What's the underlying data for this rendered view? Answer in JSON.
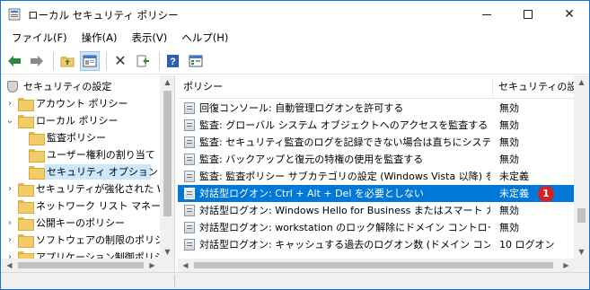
{
  "window": {
    "title": "ローカル セキュリティ ポリシー"
  },
  "menu": [
    "ファイル(F)",
    "操作(A)",
    "表示(V)",
    "ヘルプ(H)"
  ],
  "tree": {
    "root": "セキュリティの設定",
    "items": [
      {
        "label": "アカウント ポリシー",
        "level": 1
      },
      {
        "label": "ローカル ポリシー",
        "level": 1
      },
      {
        "label": "監査ポリシー",
        "level": 2
      },
      {
        "label": "ユーザー権利の割り当て",
        "level": 2
      },
      {
        "label": "セキュリティ オプション",
        "level": 2
      },
      {
        "label": "セキュリティが強化された Wi",
        "level": 1
      },
      {
        "label": "ネットワーク リスト マネージャ",
        "level": 1
      },
      {
        "label": "公開キーのポリシー",
        "level": 1
      },
      {
        "label": "ソフトウェアの制限のポリシー",
        "level": 1
      },
      {
        "label": "アプリケーション制御ポリシー",
        "level": 1
      }
    ]
  },
  "columns": {
    "policy": "ポリシー",
    "setting": "セキュリティの設定"
  },
  "rows": [
    {
      "policy": "回復コンソール: 自動管理ログオンを許可する",
      "setting": "無効"
    },
    {
      "policy": "監査: グローバル システム オブジェクトへのアクセスを監査する",
      "setting": "無効"
    },
    {
      "policy": "監査: セキュリティ監査のログを記録できない場合は直ちにシステムを...",
      "setting": "無効"
    },
    {
      "policy": "監査: バックアップと復元の特権の使用を監査する",
      "setting": "無効"
    },
    {
      "policy": "監査: 監査ポリシー サブカテゴリの設定 (Windows Vista 以降) を...",
      "setting": "未定義"
    },
    {
      "policy": "対話型ログオン: Ctrl + Alt + Del を必要としない",
      "setting": "未定義"
    },
    {
      "policy": "対話型ログオン: Windows Hello for Business またはスマート カード",
      "setting": "無効"
    },
    {
      "policy": "対話型ログオン: workstation のロック解除にドメイン コントローラーの...",
      "setting": "無効"
    },
    {
      "policy": "対話型ログオン: キャッシュする過去のログオン数 (ドメイン コントローラ...",
      "setting": "10 ログオン"
    }
  ],
  "badge": "1"
}
